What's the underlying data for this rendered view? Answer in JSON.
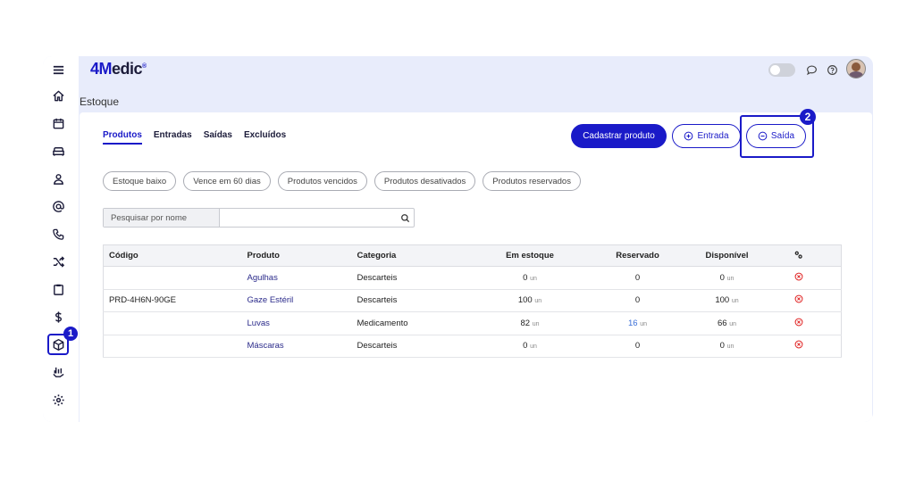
{
  "app": {
    "logo_brand": "4M",
    "logo_rest": "edic",
    "logo_mark": "®"
  },
  "page": {
    "title": "Estoque"
  },
  "tabs": [
    {
      "label": "Produtos",
      "active": true
    },
    {
      "label": "Entradas",
      "active": false
    },
    {
      "label": "Saídas",
      "active": false
    },
    {
      "label": "Excluídos",
      "active": false
    }
  ],
  "actions": {
    "register_label": "Cadastrar produto",
    "entrada_label": "Entrada",
    "saida_label": "Saída"
  },
  "badges": {
    "sidebar": "1",
    "saida": "2"
  },
  "filters": [
    "Estoque baixo",
    "Vence em 60 dias",
    "Produtos vencidos",
    "Produtos desativados",
    "Produtos reservados"
  ],
  "search": {
    "label": "Pesquisar por nome",
    "value": ""
  },
  "table": {
    "headers": [
      "Código",
      "Produto",
      "Categoria",
      "Em estoque",
      "Reservado",
      "Disponível"
    ],
    "unit": "un",
    "rows": [
      {
        "code": "",
        "product": "Agulhas",
        "category": "Descarteis",
        "stock": "0",
        "reserved": "0",
        "available": "0"
      },
      {
        "code": "PRD-4H6N-90GE",
        "product": "Gaze Estéril",
        "category": "Descarteis",
        "stock": "100",
        "reserved": "0",
        "available": "100"
      },
      {
        "code": "",
        "product": "Luvas",
        "category": "Medicamento",
        "stock": "82",
        "reserved": "16",
        "available": "66"
      },
      {
        "code": "",
        "product": "Máscaras",
        "category": "Descarteis",
        "stock": "0",
        "reserved": "0",
        "available": "0"
      }
    ]
  },
  "colors": {
    "accent": "#1a1ac8",
    "delete": "#e02424",
    "background": "#e8ecfb"
  }
}
